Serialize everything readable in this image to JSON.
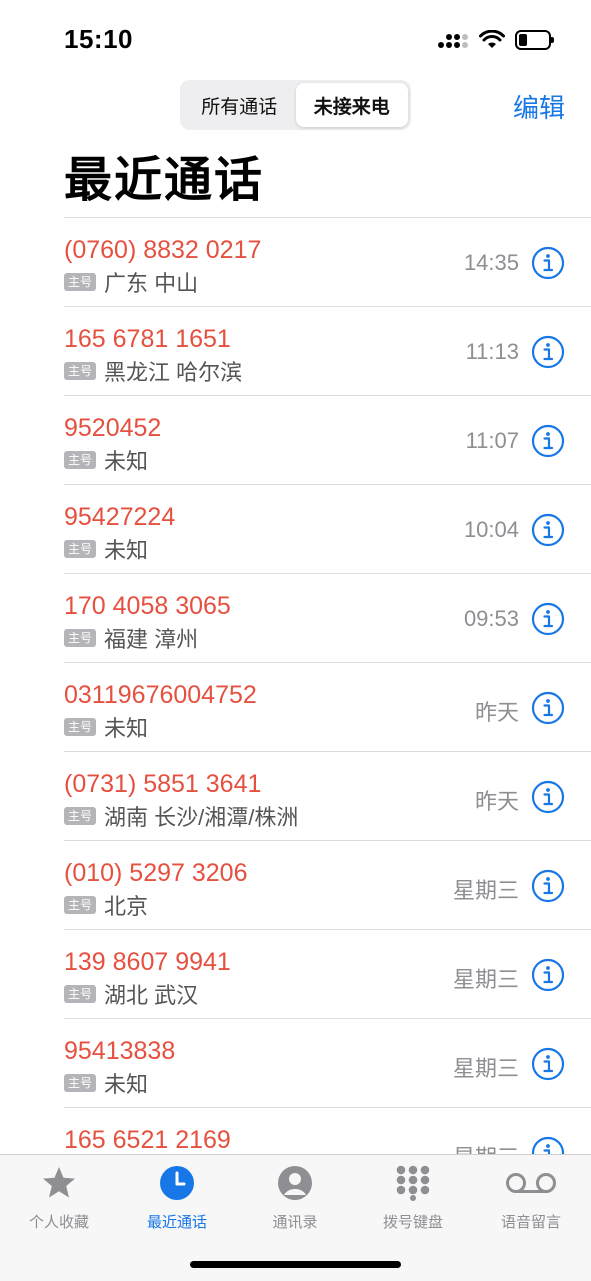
{
  "status_bar": {
    "time": "15:10"
  },
  "segments": [
    {
      "label": "所有通话",
      "active": false
    },
    {
      "label": "未接来电",
      "active": true
    }
  ],
  "edit_label": "编辑",
  "title": "最近通话",
  "tag_label": "主号",
  "calls": [
    {
      "number": "(0760) 8832 0217",
      "location": "广东 中山",
      "time": "14:35"
    },
    {
      "number": "165 6781 1651",
      "location": "黑龙江 哈尔滨",
      "time": "11:13"
    },
    {
      "number": "9520452",
      "location": "未知",
      "time": "11:07"
    },
    {
      "number": "95427224",
      "location": "未知",
      "time": "10:04"
    },
    {
      "number": "170 4058 3065",
      "location": "福建 漳州",
      "time": "09:53"
    },
    {
      "number": "03119676004752",
      "location": "未知",
      "time": "昨天"
    },
    {
      "number": "(0731) 5851 3641",
      "location": "湖南 长沙/湘潭/株洲",
      "time": "昨天"
    },
    {
      "number": "(010) 5297 3206",
      "location": "北京",
      "time": "星期三"
    },
    {
      "number": "139 8607 9941",
      "location": "湖北 武汉",
      "time": "星期三"
    },
    {
      "number": "95413838",
      "location": "未知",
      "time": "星期三"
    },
    {
      "number": "165 6521 2169",
      "location": "",
      "time": "星期三"
    }
  ],
  "tabs": [
    {
      "label": "个人收藏",
      "icon": "star-icon",
      "active": false
    },
    {
      "label": "最近通话",
      "icon": "clock-icon",
      "active": true
    },
    {
      "label": "通讯录",
      "icon": "contacts-icon",
      "active": false
    },
    {
      "label": "拨号键盘",
      "icon": "keypad-icon",
      "active": false
    },
    {
      "label": "语音留言",
      "icon": "voicemail-icon",
      "active": false
    }
  ],
  "colors": {
    "accent": "#1877e6",
    "missed": "#e5503f",
    "tab_inactive": "#8e8e93"
  }
}
